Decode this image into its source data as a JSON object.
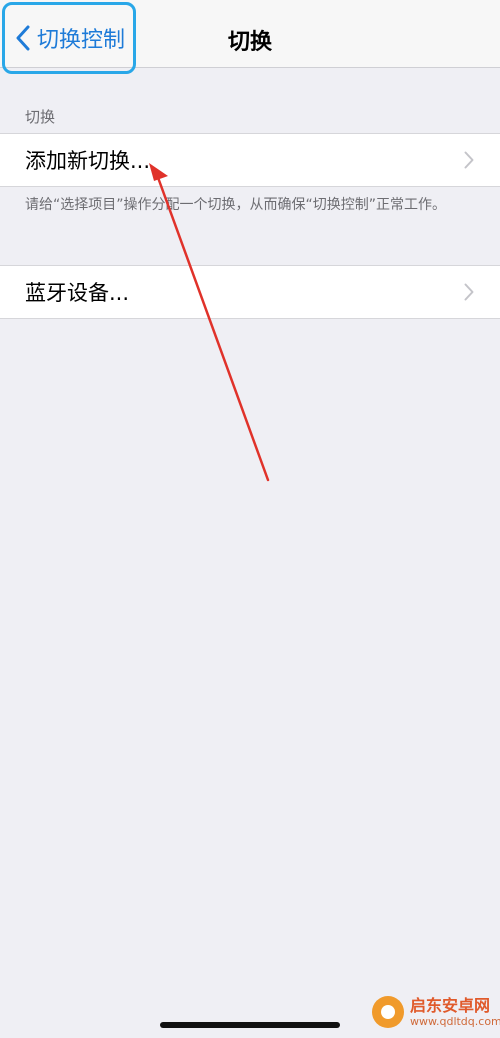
{
  "navbar": {
    "back_label": "切换控制",
    "title": "切换"
  },
  "section": {
    "header": "切换"
  },
  "rows": {
    "add_switch": "添加新切换...",
    "bluetooth": "蓝牙设备..."
  },
  "footer": {
    "text": "请给“选择项目”操作分配一个切换，从而确保“切换控制”正常工作。"
  },
  "watermark": {
    "title": "启东安卓网",
    "url": "www.qdltdq.com"
  },
  "colors": {
    "accent": "#1e7bd8",
    "highlight_border": "#29a7e8",
    "annotation_arrow": "#e0322a",
    "background": "#efeff4"
  },
  "icons": {
    "back": "chevron-left-icon",
    "disclosure": "chevron-right-icon"
  }
}
